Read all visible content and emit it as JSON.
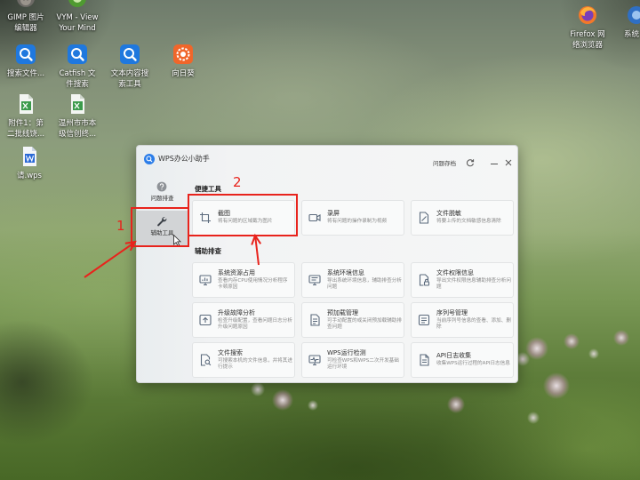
{
  "desktop": {
    "icons": [
      {
        "icon": "gimp-icon",
        "line1": "GIMP 图片",
        "line2": "编辑器"
      },
      {
        "icon": "vym-icon",
        "line1": "VYM - View",
        "line2": "Your Mind"
      },
      {
        "icon": "search-icon",
        "line1": "搜索文件..."
      },
      {
        "icon": "search-icon",
        "line1": "Catfish 文",
        "line2": "件搜索"
      },
      {
        "icon": "search-icon",
        "line1": "文本内容搜",
        "line2": "索工具"
      },
      {
        "icon": "sunlogin-icon",
        "line1": "向日葵"
      },
      {
        "icon": "spreadsheet-file-icon",
        "line1": "附件1：第",
        "line2": "二批线饶..."
      },
      {
        "icon": "spreadsheet-file-icon",
        "line1": "温州市市本",
        "line2": "级信创终..."
      },
      {
        "icon": "wps-document-icon",
        "line1": "请.wps"
      },
      {
        "icon": "firefox-icon",
        "line1": "Firefox 网",
        "line2": "络浏览器"
      },
      {
        "icon": "system-app-icon",
        "line1": "系统"
      }
    ]
  },
  "window": {
    "title": "WPS办公小助手",
    "archive_label": "问题存档",
    "sidebar": [
      {
        "label": "问题排查",
        "icon": "question-circle-icon",
        "active": false
      },
      {
        "label": "辅助工具",
        "icon": "wrench-icon",
        "active": true
      }
    ],
    "sections": [
      {
        "title": "便捷工具",
        "tools": [
          {
            "name": "截图",
            "desc": "将有问题的区域截为图片",
            "icon": "screenshot-icon"
          },
          {
            "name": "录屏",
            "desc": "将有问题的操作录制为视频",
            "icon": "screen-record-icon"
          },
          {
            "name": "文件脱敏",
            "desc": "将要上传的文档敏感信息清除",
            "icon": "file-desensitize-icon"
          }
        ]
      },
      {
        "title": "辅助排查",
        "tools": [
          {
            "name": "系统资源占用",
            "desc": "查看内存CPU使用情况分析程序卡顿原因",
            "icon": "system-resource-icon"
          },
          {
            "name": "系统环境信息",
            "desc": "导出系统环境信息，辅助排查分析问题",
            "icon": "system-env-icon"
          },
          {
            "name": "文件权限信息",
            "desc": "导出文件权限信息辅助排查分析问题",
            "icon": "file-permission-icon"
          },
          {
            "name": "升级故障分析",
            "desc": "检查升级配置，查看问题日志分析升级问题原因",
            "icon": "upgrade-icon"
          },
          {
            "name": "预加载管理",
            "desc": "可手动配置的或关闭预加载辅助排查问题",
            "icon": "preload-icon"
          },
          {
            "name": "序列号管理",
            "desc": "当前序列号信息的查看、添加、删除",
            "icon": "serial-number-icon"
          },
          {
            "name": "文件搜索",
            "desc": "可搜索本机的文件信息，并将其进行提示",
            "icon": "file-search-icon"
          },
          {
            "name": "WPS运行检测",
            "desc": "可检查WPS和WPS二次开发基础运行环境",
            "icon": "wps-run-check-icon"
          },
          {
            "name": "API日志收集",
            "desc": "收集WPS运行过程的API日志信息",
            "icon": "api-log-icon"
          }
        ]
      }
    ]
  },
  "annotations": {
    "step_1": "1",
    "step_2": "2"
  },
  "colors": {
    "accent": "#2b7de9",
    "annotation": "#e8231c",
    "active_item_bg": "#d2d4d6"
  }
}
